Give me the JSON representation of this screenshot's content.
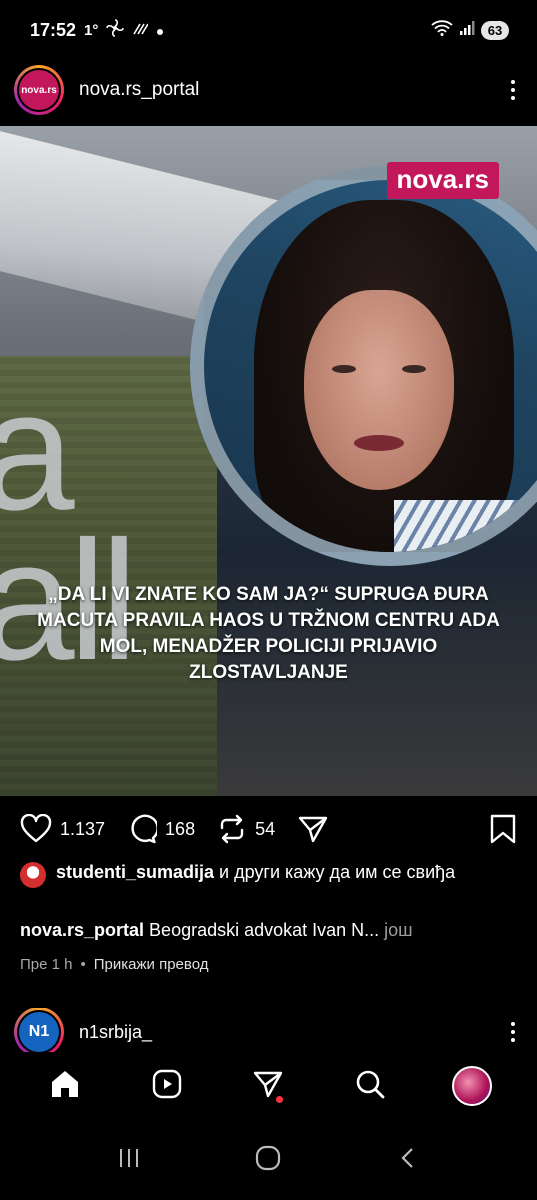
{
  "status_bar": {
    "time": "17:52",
    "temperature": "1°",
    "battery": "63"
  },
  "post": {
    "username": "nova.rs_portal",
    "avatar_text": "nova.rs",
    "image": {
      "watermark": "nova.rs",
      "background_letters": "a\nall",
      "headline": "„DA LI VI ZNATE KO SAM JA?“ SUPRUGA ĐURA MACUTA PRAVILA HAOS U TRŽNOM CENTRU ADA MOL, MENADŽER POLICIJI PRIJAVIO ZLOSTAVLJANJE"
    },
    "actions": {
      "likes": "1.137",
      "comments": "168",
      "reposts": "54"
    },
    "liked_by": {
      "username": "studenti_sumadija",
      "text": " и други кажу да им се свиђа"
    },
    "caption": {
      "username": "nova.rs_portal",
      "text": " Beogradski advokat Ivan N...",
      "more": " још"
    },
    "meta": {
      "time": "Пре 1 h",
      "separator": "•",
      "translate": "Прикажи превод"
    }
  },
  "next_post": {
    "username": "n1srbija_",
    "avatar_text": "N1"
  },
  "colors": {
    "brand": "#c2185b",
    "notification": "#ff3040"
  }
}
